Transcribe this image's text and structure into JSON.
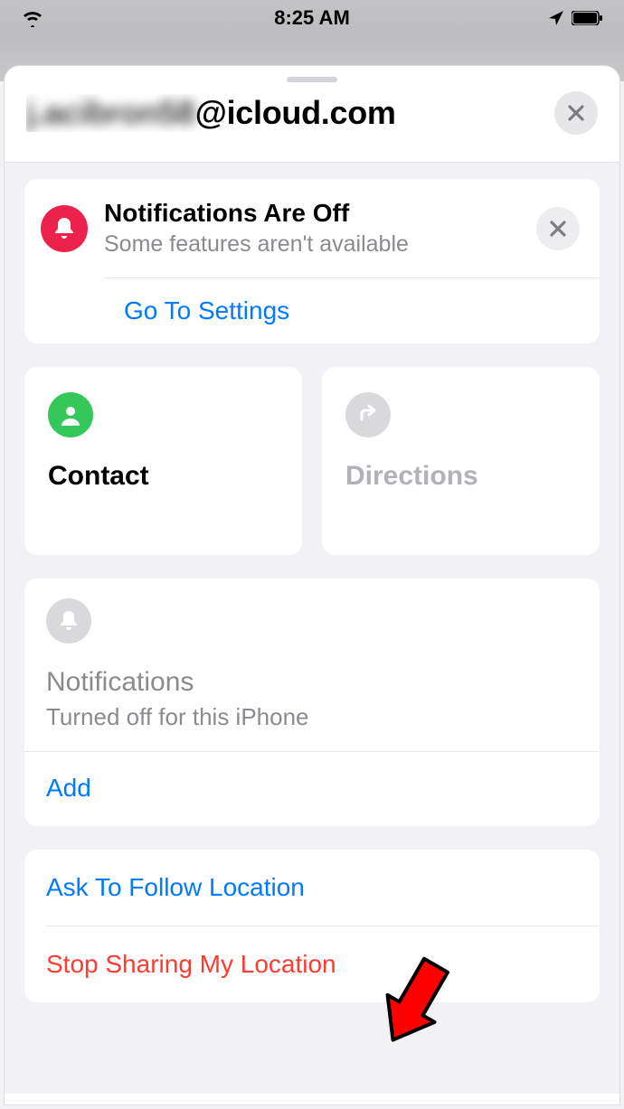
{
  "status": {
    "time": "8:25 AM"
  },
  "sheet": {
    "title_blurred": "j.acibron58",
    "title_suffix": "@icloud.com"
  },
  "notificationBanner": {
    "title": "Notifications Are Off",
    "subtitle": "Some features aren't available",
    "action": "Go To Settings"
  },
  "tiles": {
    "contact": "Contact",
    "directions": "Directions"
  },
  "notificationsSection": {
    "title": "Notifications",
    "subtitle": "Turned off for this iPhone",
    "add": "Add"
  },
  "locationActions": {
    "askFollow": "Ask To Follow Location",
    "stopSharing": "Stop Sharing My Location"
  }
}
